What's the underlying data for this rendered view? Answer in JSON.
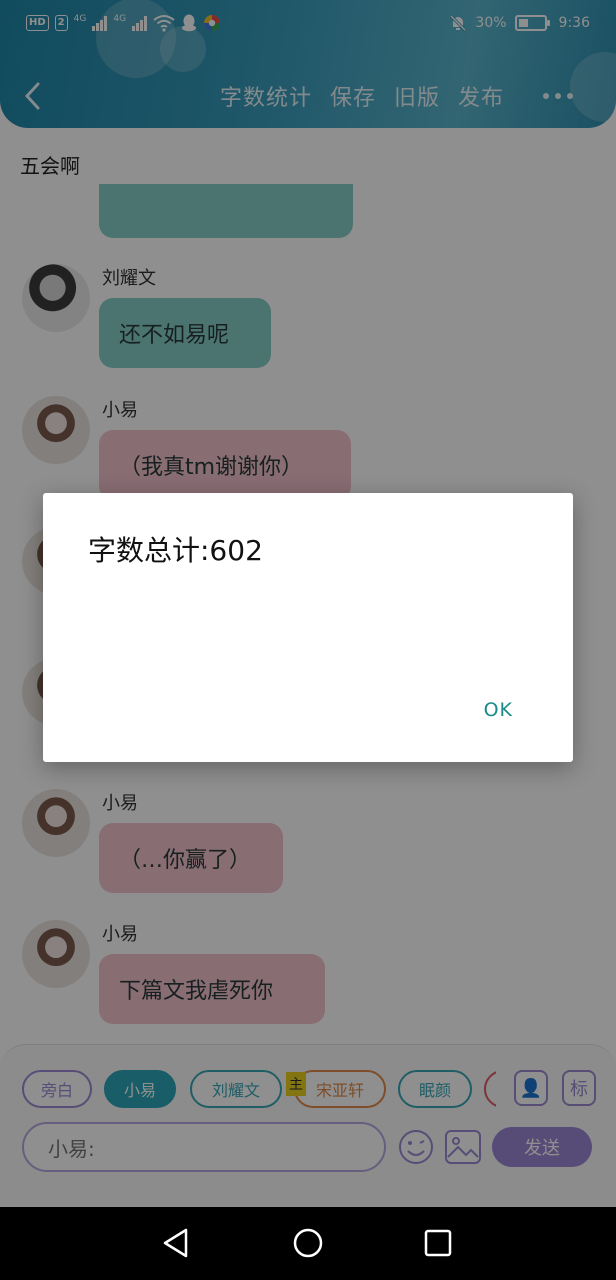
{
  "status_bar": {
    "left_badges": [
      "HD",
      "2",
      "4G",
      "4G"
    ],
    "battery": "30%",
    "time": "9:36",
    "icons": [
      "hd-badge",
      "signal-icon",
      "wifi-icon",
      "qq-icon",
      "app-icon",
      "mute-bell-icon",
      "battery-icon"
    ]
  },
  "header": {
    "back_icon": "chevron-left-icon",
    "actions": [
      "字数统计",
      "保存",
      "旧版",
      "发布"
    ],
    "more_icon": "more-dots-icon"
  },
  "conversation_title": "五会啊",
  "messages": [
    {
      "sender": "",
      "text": "",
      "color": "teal",
      "avatar": "none"
    },
    {
      "sender": "刘耀文",
      "text": "还不如易呢",
      "color": "teal",
      "avatar": "male"
    },
    {
      "sender": "小易",
      "text": "（我真tm谢谢你）",
      "color": "pink",
      "avatar": "female"
    },
    {
      "sender": "小易",
      "text": "（…你赢了）",
      "color": "pink",
      "avatar": "female"
    },
    {
      "sender": "小易",
      "text": "下篇文我虐死你",
      "color": "pink",
      "avatar": "female"
    }
  ],
  "roles": [
    {
      "label": "旁白",
      "style": "outline",
      "color": "#9b89d3"
    },
    {
      "label": "小易",
      "style": "filled",
      "color": "#2ba7b8"
    },
    {
      "label": "刘耀文",
      "style": "outline",
      "color": "#3aa8b6"
    },
    {
      "label": "宋亚轩",
      "style": "outline",
      "color": "#e08a4a",
      "tag": "主"
    },
    {
      "label": "眠颜",
      "style": "outline",
      "color": "#3aa8b6"
    },
    {
      "label": "",
      "style": "outline",
      "color": "#e05a6a"
    }
  ],
  "tools": [
    {
      "icon": "contact-card-icon",
      "glyph": "👤"
    },
    {
      "icon": "tag-icon",
      "glyph": "标"
    }
  ],
  "input": {
    "value": "小易:",
    "emoji_icon": "emoji-icon",
    "image_icon": "image-icon"
  },
  "send_label": "发送",
  "dialog": {
    "message": "字数总计:602",
    "ok_label": "OK"
  },
  "colors": {
    "header": "#2d90b0",
    "teal_bubble": "#86cfc9",
    "pink_bubble": "#f3c2cd",
    "accent_purple": "#9b87d6",
    "ok_text": "#1a8a8a"
  }
}
